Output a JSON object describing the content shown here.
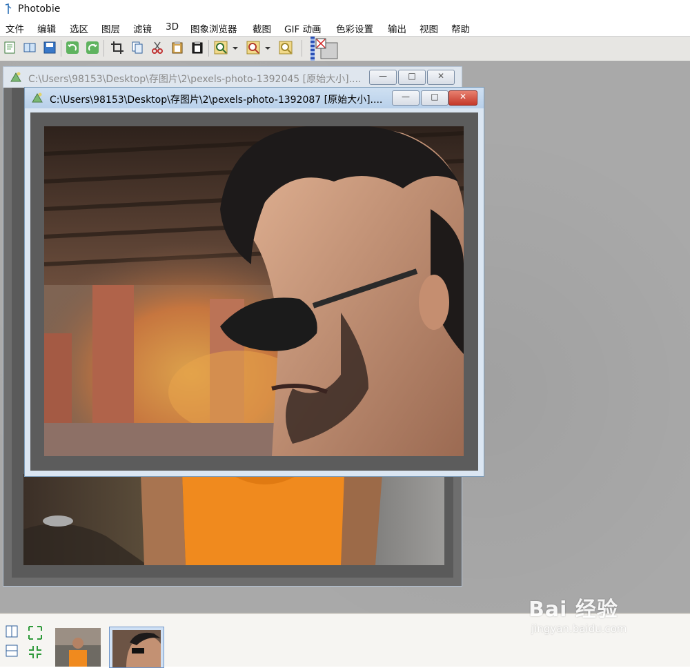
{
  "app": {
    "title": "Photobie"
  },
  "menu": [
    "文件",
    "编辑",
    "选区",
    "图层",
    "滤镜",
    "3D",
    "图象浏览器",
    "截图",
    "GIF 动画",
    "色彩设置",
    "输出",
    "视图",
    "帮助"
  ],
  "windows": [
    {
      "title": "C:\\Users\\98153\\Desktop\\存图片\\2\\pexels-photo-1392045 [原始大小]....",
      "active": false
    },
    {
      "title": "C:\\Users\\98153\\Desktop\\存图片\\2\\pexels-photo-1392087 [原始大小]....",
      "active": true
    }
  ],
  "window_controls": {
    "minimize": "—",
    "maximize": "□",
    "close": "✕"
  },
  "toolbar_icons": [
    "new-icon",
    "open-icon",
    "save-icon",
    "undo-icon",
    "redo-icon",
    "crop-icon",
    "copy-icon",
    "cut-icon",
    "paste-icon",
    "paste-new-icon",
    "zoom-in-icon",
    "zoom-out-icon",
    "zoom-fit-icon",
    "color-swatch-icon"
  ],
  "watermark": {
    "brand": "Bai 经验",
    "url": "jingyan.baidu.com"
  },
  "colors": {
    "workspace": "#a9a9a9",
    "active_title": "#c4d8ee",
    "close_button": "#c4382a",
    "shirt_orange": "#f08a1e"
  }
}
